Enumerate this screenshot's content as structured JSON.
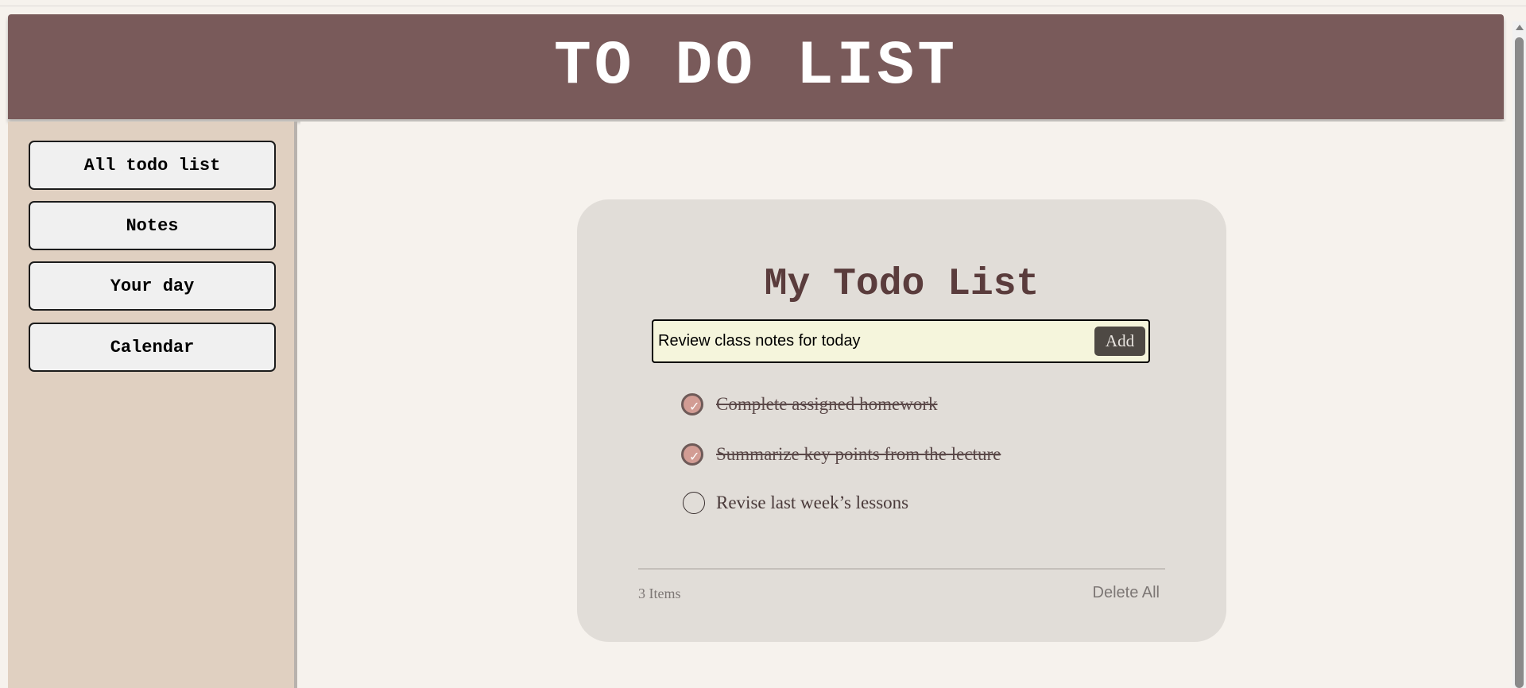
{
  "header": {
    "title": "TO DO LIST"
  },
  "sidebar": {
    "items": [
      {
        "label": "All todo list"
      },
      {
        "label": "Notes"
      },
      {
        "label": "Your day"
      },
      {
        "label": "Calendar"
      }
    ]
  },
  "card": {
    "title": "My Todo List",
    "input": {
      "value": "Review class notes for today",
      "add_label": "Add"
    },
    "todos": [
      {
        "text": "Complete assigned homework",
        "done": true
      },
      {
        "text": "Summarize key points from the lecture",
        "done": true
      },
      {
        "text": "Revise last week’s lessons",
        "done": false
      }
    ],
    "footer": {
      "count_label": "3 Items",
      "delete_all_label": "Delete All"
    }
  },
  "icons": {
    "check": "checkmark-icon",
    "scroll_up": "arrow-up-icon"
  },
  "colors": {
    "header_bg": "#795a5a",
    "sidebar_bg": "#e0d0c1",
    "card_bg": "#e1ddd8",
    "input_bg": "#f5f5dc",
    "checked_fill": "#d29c94",
    "add_button_bg": "#4e4944"
  }
}
